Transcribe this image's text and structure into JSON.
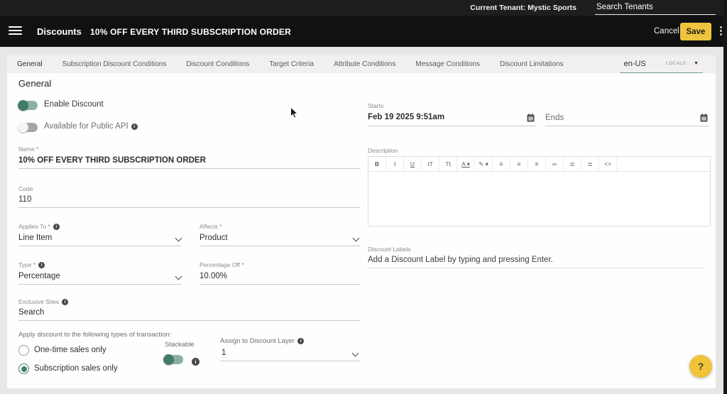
{
  "colors": {
    "accent_yellow": "#eec43e",
    "accent_green": "#447c6b",
    "locale_underline": "#67a08e",
    "header_bg": "#111111",
    "topbar_bg": "#1e1e1e",
    "page_bg": "#e8e7e5"
  },
  "topbar": {
    "current_tenant": "Current Tenant: Mystic Sports",
    "search_value": "Search Tenants"
  },
  "header": {
    "app_title": "Discounts",
    "record_title": "10% OFF EVERY THIRD SUBSCRIPTION ORDER",
    "cancel_label": "Cancel",
    "save_label": "Save",
    "kebab": "⋮"
  },
  "tabs": [
    {
      "label": "General",
      "active": true
    },
    {
      "label": "Subscription Discount Conditions",
      "active": false
    },
    {
      "label": "Discount Conditions",
      "active": false
    },
    {
      "label": "Target Criteria",
      "active": false
    },
    {
      "label": "Attribute Conditions",
      "active": false
    },
    {
      "label": "Message Conditions",
      "active": false
    },
    {
      "label": "Discount Limitations",
      "active": false
    }
  ],
  "locale": {
    "value": "en-US",
    "tag": "LOCALE"
  },
  "general": {
    "section_title": "General",
    "enable_discount": {
      "label": "Enable Discount",
      "on": true
    },
    "public_api": {
      "label": "Available for Public API",
      "on": false
    },
    "name": {
      "label": "Name *",
      "value": "10% OFF EVERY THIRD SUBSCRIPTION ORDER"
    },
    "code": {
      "label": "Code",
      "value": "110"
    },
    "applies_to": {
      "label": "Applies To *",
      "value": "Line Item"
    },
    "affects": {
      "label": "Affects *",
      "value": "Product"
    },
    "type": {
      "label": "Type *",
      "value": "Percentage"
    },
    "percentage_off": {
      "label": "Percentage Off *",
      "value": "10.00%"
    },
    "exclusive_sites": {
      "label": "Exclusive Sites",
      "value": "Search"
    },
    "transaction_heading": "Apply discount to the following types of transaction:",
    "transaction_options": [
      {
        "label": "One-time sales only",
        "selected": false
      },
      {
        "label": "Subscription sales only",
        "selected": true
      }
    ],
    "stackable": {
      "label": "Stackable",
      "on": true
    },
    "discount_layer": {
      "label": "Assign to Discount Layer",
      "value": "1"
    }
  },
  "schedule": {
    "starts": {
      "label": "Starts",
      "value": "Feb 19 2025 9:51am"
    },
    "ends": {
      "placeholder": "Ends"
    }
  },
  "description": {
    "label": "Description",
    "toolbar": [
      {
        "name": "bold",
        "glyph": "B"
      },
      {
        "name": "italic",
        "glyph": "I"
      },
      {
        "name": "underline",
        "glyph": "U"
      },
      {
        "name": "subscript",
        "glyph": "tT"
      },
      {
        "name": "superscript",
        "glyph": "Tt"
      },
      {
        "name": "text-color",
        "glyph": "A ▾"
      },
      {
        "name": "highlight-color",
        "glyph": "✎ ▾"
      },
      {
        "name": "align-left",
        "glyph": "≡"
      },
      {
        "name": "align-center",
        "glyph": "≡"
      },
      {
        "name": "align-right",
        "glyph": "≡"
      },
      {
        "name": "link",
        "glyph": "∞"
      },
      {
        "name": "ordered-list",
        "glyph": "≣"
      },
      {
        "name": "unordered-list",
        "glyph": "≣"
      },
      {
        "name": "code-view",
        "glyph": "<>"
      }
    ]
  },
  "discount_labels": {
    "label": "Discount Labels",
    "placeholder": "Add a Discount Label by typing and pressing Enter."
  },
  "help_button": {
    "label": "?"
  }
}
